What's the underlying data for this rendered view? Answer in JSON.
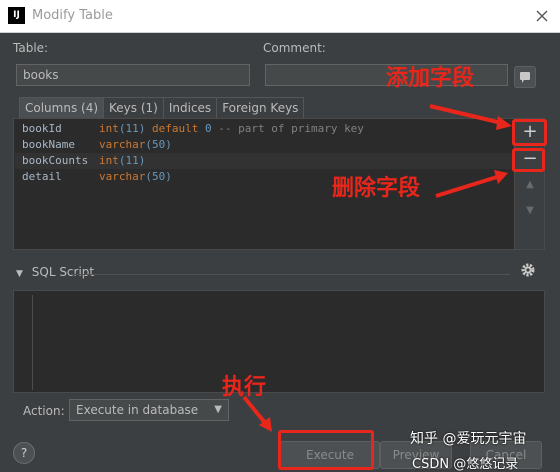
{
  "window": {
    "title": "Modify Table",
    "app_icon_text": "IJ"
  },
  "form": {
    "table_label": "Table:",
    "table_value": "books",
    "comment_label": "Comment:",
    "comment_value": ""
  },
  "tabs": [
    {
      "label": "Columns (4)",
      "active": true
    },
    {
      "label": "Keys (1)",
      "active": false
    },
    {
      "label": "Indices",
      "active": false
    },
    {
      "label": "Foreign Keys",
      "active": false
    }
  ],
  "columns": [
    {
      "name": "bookId",
      "type": "int",
      "args": "(11)",
      "default_kw": "default",
      "default_val": "0",
      "comment": "-- part of primary key"
    },
    {
      "name": "bookName",
      "type": "varchar",
      "args": "(50)"
    },
    {
      "name": "bookCounts",
      "type": "int",
      "args": "(11)"
    },
    {
      "name": "detail",
      "type": "varchar",
      "args": "(50)"
    }
  ],
  "sidebar": {
    "add": "+",
    "remove": "−",
    "up": "▲",
    "down": "▼"
  },
  "sql": {
    "header": "SQL Script"
  },
  "action": {
    "label": "Action:",
    "value": "Execute in database"
  },
  "buttons": {
    "help": "?",
    "execute": "Execute",
    "preview": "Preview",
    "cancel": "Cancel"
  },
  "annotations": {
    "add_field": "添加字段",
    "delete_field": "删除字段",
    "execute": "执行"
  },
  "watermark": {
    "line1": "知乎 @爱玩元宇宙",
    "line2": "CSDN @悠悠记录"
  },
  "colors": {
    "annotation_red": "#e8261b",
    "keyword": "#cc7832",
    "number": "#6897bb",
    "comment": "#808080"
  }
}
